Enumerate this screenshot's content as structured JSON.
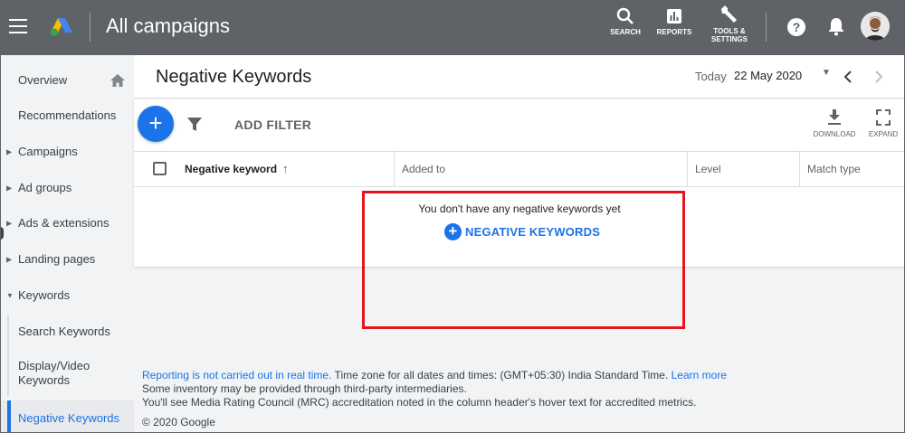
{
  "header": {
    "title": "All campaigns",
    "buttons": [
      {
        "label": "SEARCH",
        "icon": "search-icon"
      },
      {
        "label": "REPORTS",
        "icon": "reports-icon"
      },
      {
        "label": "TOOLS &",
        "label2": "SETTINGS",
        "icon": "wrench-icon"
      }
    ],
    "help_icon": "help-icon",
    "notification_icon": "bell-icon",
    "avatar_icon": "avatar"
  },
  "sidebar": {
    "items": [
      {
        "label": "Overview",
        "has_home_icon": true
      },
      {
        "label": "Recommendations"
      },
      {
        "label": "Campaigns",
        "expandable": true
      },
      {
        "label": "Ad groups",
        "expandable": true
      },
      {
        "label": "Ads & extensions",
        "expandable": true
      },
      {
        "label": "Landing pages",
        "expandable": true
      },
      {
        "label": "Keywords",
        "expanded": true
      },
      {
        "label": "Search Keywords"
      },
      {
        "label": "Display/Video Keywords"
      },
      {
        "label": "Negative Keywords",
        "active": true
      }
    ]
  },
  "page": {
    "title": "Negative Keywords",
    "date_label": "Today",
    "date_value": "22 May 2020"
  },
  "toolbar": {
    "add_filter": "ADD FILTER",
    "download": "DOWNLOAD",
    "expand": "EXPAND"
  },
  "table": {
    "columns": [
      "Negative keyword",
      "Added to",
      "Level",
      "Match type"
    ],
    "empty_message": "You don't have any negative keywords yet",
    "add_button": "NEGATIVE KEYWORDS"
  },
  "footer": {
    "line1_link": "Reporting is not carried out in real time.",
    "line1_text": " Time zone for all dates and times: (GMT+05:30) India Standard Time. ",
    "line1_link2": "Learn more",
    "line2": "Some inventory may be provided through third-party intermediaries.",
    "line3": "You'll see Media Rating Council (MRC) accreditation noted in the column header's hover text for accredited metrics.",
    "copyright": "© 2020 Google"
  },
  "colors": {
    "topbar": "#5f6368",
    "accent": "#1a73e8",
    "highlight": "#e4161d"
  }
}
